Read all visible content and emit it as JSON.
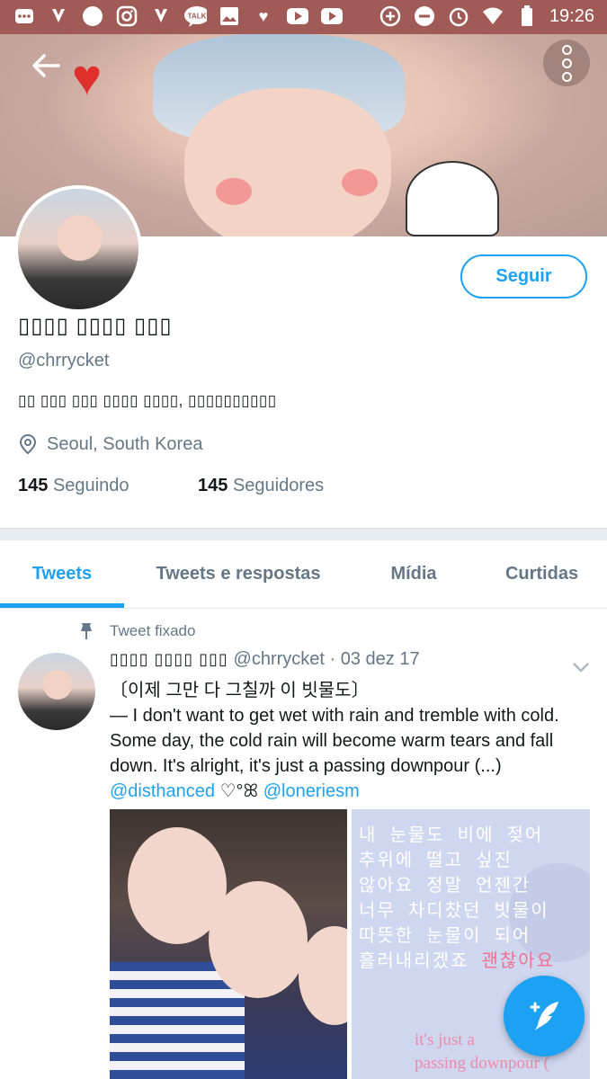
{
  "status_bar": {
    "time": "19:26",
    "icons": [
      "more-icon",
      "notification-icon",
      "circle-icon",
      "instagram-icon",
      "notification-icon",
      "talk-icon",
      "image-icon",
      "heart-icon",
      "youtube-icon",
      "youtube-icon",
      "data-saver-icon",
      "dnd-icon",
      "alarm-icon",
      "wifi-icon",
      "battery-icon"
    ],
    "talk_label": "TALK"
  },
  "profile": {
    "display_name": "▯▯▯▯ ▯▯▯▯ ▯▯▯",
    "handle": "@chrrycket",
    "bio": "▯▯ ▯▯▯ ▯▯▯ ▯▯▯▯ ▯▯▯▯, ▯▯▯▯▯▯▯▯▯▯",
    "location": "Seoul, South Korea",
    "following_count": "145",
    "following_label": "Seguindo",
    "followers_count": "145",
    "followers_label": "Seguidores",
    "follow_button": "Seguir"
  },
  "tabs": [
    {
      "label": "Tweets",
      "active": true
    },
    {
      "label": "Tweets e respostas",
      "active": false
    },
    {
      "label": "Mídia",
      "active": false
    },
    {
      "label": "Curtidas",
      "active": false
    }
  ],
  "pinned_tweet": {
    "pinned_label": "Tweet fixado",
    "author_name": "▯▯▯▯ ▯▯▯▯ ▯▯▯",
    "author_handle": "@chrrycket",
    "date": "· 03 dez 17",
    "text_line1": "〔이제 그만 다 그칠까 이 빗물도〕",
    "text_body": "— I don't want to get wet with rain and tremble  with cold. Some day, the cold rain will become warm tears and fall down. It's alright, it's just a passing downpour (...)",
    "mention1": "@disthanced",
    "separator": " ♡°ꕤ ",
    "mention2": "@loneriesm",
    "image_text_ko": "내 눈물도 비에 젖어\n추위에 떨고 싶진\n않아요 정말 언젠간\n너무 차디찼던 빗물이\n따뜻한 눈물이 되어\n흘러내리겠죠 ",
    "image_text_ko_pink": "괜찮아요",
    "image_text_en1": "it's just a",
    "image_text_en2": "passing downpour ("
  },
  "colors": {
    "accent": "#1da1f2",
    "status_bar": "#a15b57",
    "muted_text": "#657786"
  }
}
